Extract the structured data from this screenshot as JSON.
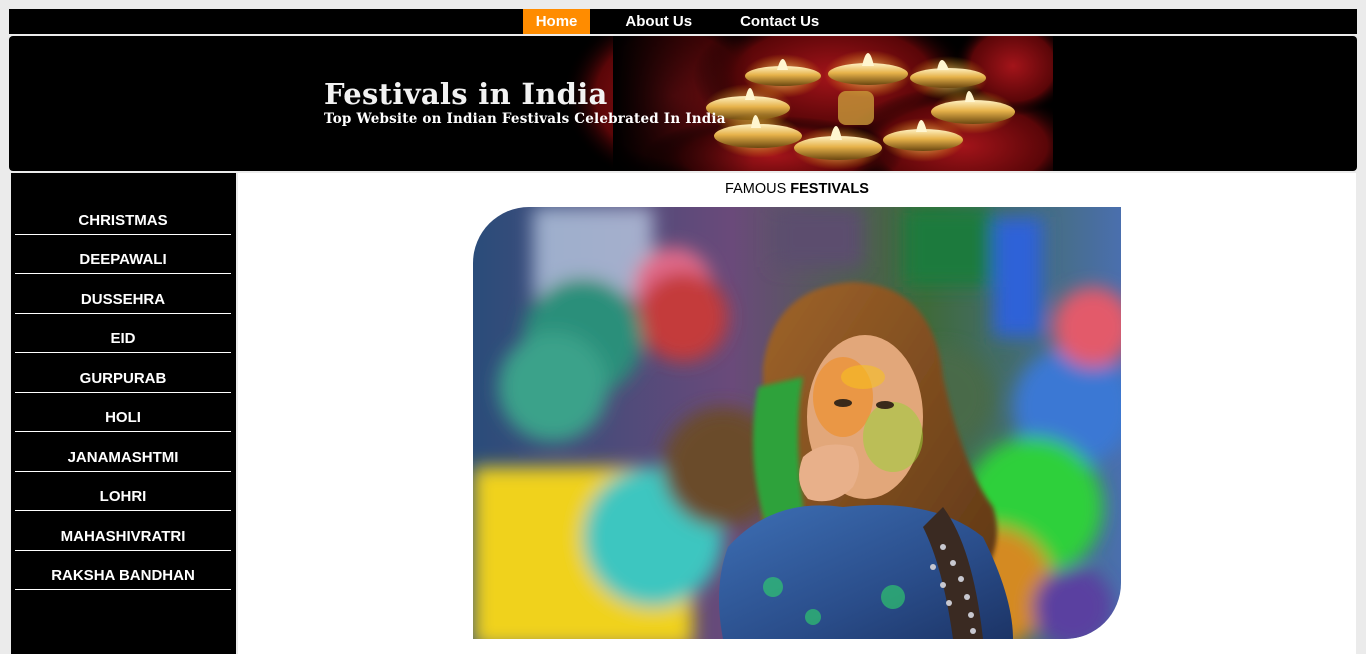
{
  "nav": {
    "items": [
      {
        "label": "Home",
        "active": true
      },
      {
        "label": "About Us",
        "active": false
      },
      {
        "label": "Contact Us",
        "active": false
      }
    ],
    "active_color": "#ff8c00"
  },
  "banner": {
    "title": "Festivals in India",
    "subtitle": "Top Website on Indian Festivals Celebrated In India"
  },
  "sidebar": {
    "items": [
      {
        "label": "CHRISTMAS"
      },
      {
        "label": "DEEPAWALI"
      },
      {
        "label": "DUSSEHRA"
      },
      {
        "label": "EID"
      },
      {
        "label": "GURPURAB"
      },
      {
        "label": "HOLI"
      },
      {
        "label": "JANAMASHTMI"
      },
      {
        "label": "LOHRI"
      },
      {
        "label": "MAHASHIVRATRI"
      },
      {
        "label": "RAKSHA BANDHAN"
      }
    ]
  },
  "main": {
    "title_prefix": "FAMOUS ",
    "title_bold": "FESTIVALS"
  }
}
